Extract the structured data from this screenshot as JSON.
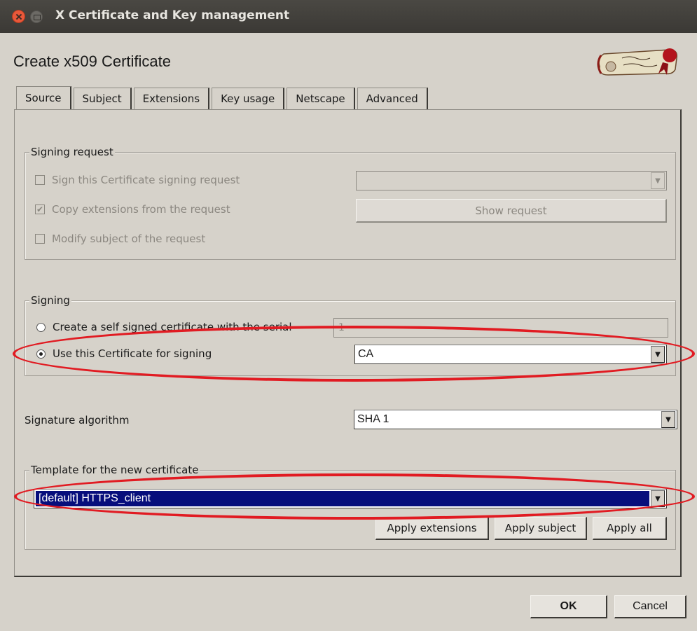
{
  "window": {
    "title": "X Certificate and Key management"
  },
  "dialog": {
    "title": "Create x509 Certificate"
  },
  "tabs": [
    "Source",
    "Subject",
    "Extensions",
    "Key usage",
    "Netscape",
    "Advanced"
  ],
  "signing_request": {
    "title": "Signing request",
    "sign_csr_label": "Sign this Certificate signing request",
    "copy_extensions_label": "Copy extensions from the request",
    "modify_subject_label": "Modify subject of the request",
    "show_request_label": "Show request",
    "csr_value": ""
  },
  "signing": {
    "title": "Signing",
    "self_signed_label": "Create a self signed certificate with the serial",
    "serial_value": "1",
    "use_cert_label": "Use this Certificate for signing",
    "ca_value": "CA"
  },
  "signature": {
    "label": "Signature algorithm",
    "value": "SHA 1"
  },
  "template": {
    "title": "Template for the new certificate",
    "value": "[default] HTTPS_client",
    "apply_extensions": "Apply extensions",
    "apply_subject": "Apply subject",
    "apply_all": "Apply all"
  },
  "footer": {
    "ok": "OK",
    "cancel": "Cancel"
  },
  "colors": {
    "highlight": "#070e7c",
    "annotation": "#e11b22",
    "background": "#d6d2ca"
  }
}
